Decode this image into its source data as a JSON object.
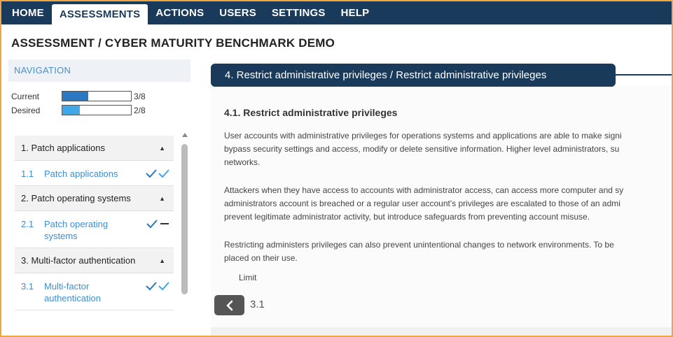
{
  "topnav": {
    "tabs": [
      {
        "label": "HOME",
        "active": false
      },
      {
        "label": "ASSESSMENTS",
        "active": true
      },
      {
        "label": "ACTIONS",
        "active": false
      },
      {
        "label": "USERS",
        "active": false
      },
      {
        "label": "SETTINGS",
        "active": false
      },
      {
        "label": "HELP",
        "active": false
      }
    ]
  },
  "page_title": "ASSESSMENT / CYBER MATURITY BENCHMARK DEMO",
  "navigation": {
    "header": "NAVIGATION",
    "progress": [
      {
        "label": "Current",
        "value": "3/8",
        "fraction": 0.375,
        "color": "#2b78c2"
      },
      {
        "label": "Desired",
        "value": "2/8",
        "fraction": 0.25,
        "color": "#3fa9e8"
      }
    ],
    "groups": [
      {
        "title": "1. Patch applications",
        "items": [
          {
            "num": "1.1",
            "name": "Patch applications",
            "current": "check",
            "desired": "check"
          }
        ]
      },
      {
        "title": "2. Patch operating systems",
        "items": [
          {
            "num": "2.1",
            "name": "Patch operating systems",
            "current": "check",
            "desired": "dash"
          }
        ]
      },
      {
        "title": "3. Multi-factor authentication",
        "items": [
          {
            "num": "3.1",
            "name": "Multi-factor authentication",
            "current": "check",
            "desired": "check"
          }
        ]
      }
    ]
  },
  "content": {
    "title": "4. Restrict administrative privileges / Restrict administrative privileges",
    "heading": "4.1. Restrict administrative privileges",
    "paragraphs": [
      [
        "User accounts with administrative privileges for operations systems and applications are able to make signi",
        "bypass security settings and access, modify or delete sensitive information. Higher level administrators, su",
        "networks."
      ],
      [
        "Attackers when they have access to accounts with administrator access, can access more computer and sy",
        "administrators account is breached or a regular user account's privileges are escalated to those of an admi",
        "prevent legitimate administrator activity, but introduce safeguards from preventing account misuse."
      ],
      [
        "Restricting administers privileges can also prevent unintentional changes to network environments. To be",
        "placed on their use."
      ]
    ],
    "limit_label": "Limit",
    "back_ref": "3.1"
  },
  "colors": {
    "brand_navy": "#1a3a5c",
    "link_blue": "#3d8ed0",
    "frame_orange": "#f0a640"
  }
}
